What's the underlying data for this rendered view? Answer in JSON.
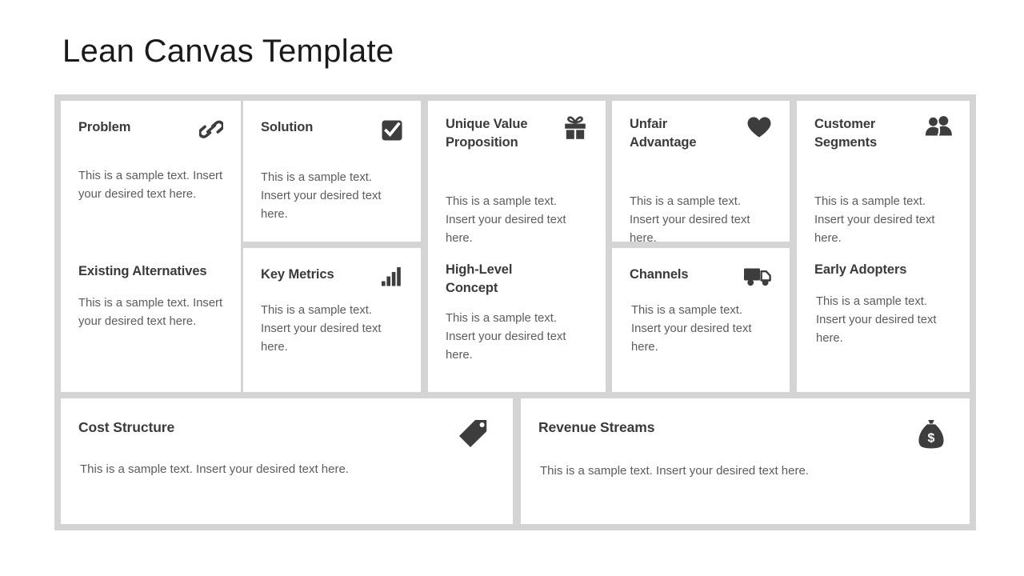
{
  "page": {
    "title": "Lean Canvas Template",
    "background_color": "#ffffff",
    "canvas_background_color": "#d4d4d4",
    "card_background_color": "#ffffff",
    "heading_color": "#3b3b3b",
    "body_color": "#5c5c5c"
  },
  "sample_text": "This is a sample text. Insert your desired text here.",
  "blocks": {
    "problem": {
      "title": "Problem",
      "body": "This is a sample text. Insert your desired text here.",
      "icon": "chain-link-icon"
    },
    "existing_alternatives": {
      "title": "Existing Alternatives",
      "body": "This is a sample text. Insert your desired text here.",
      "icon": null
    },
    "solution": {
      "title": "Solution",
      "body": "This is a sample text. Insert your desired text here.",
      "icon": "check-square-icon"
    },
    "key_metrics": {
      "title": "Key Metrics",
      "body": "This is a sample text. Insert your desired text here.",
      "icon": "bar-chart-icon"
    },
    "unique_value_proposition": {
      "title": "Unique Value Proposition",
      "body": "This is a sample text. Insert your desired text here.",
      "icon": "gift-icon"
    },
    "high_level_concept": {
      "title": "High-Level Concept",
      "body": "This is a sample text. Insert your desired text here.",
      "icon": null
    },
    "unfair_advantage": {
      "title": "Unfair Advantage",
      "body": "This is a sample text. Insert your desired text here.",
      "icon": "heart-icon"
    },
    "channels": {
      "title": "Channels",
      "body": "This is a sample text. Insert your desired text here.",
      "icon": "delivery-truck-icon"
    },
    "customer_segments": {
      "title": "Customer Segments",
      "body": "This is a sample text. Insert your desired text here.",
      "icon": "two-people-icon"
    },
    "early_adopters": {
      "title": "Early Adopters",
      "body": "This is a sample text. Insert your desired text here.",
      "icon": null
    },
    "cost_structure": {
      "title": "Cost Structure",
      "body": "This is a sample text. Insert your desired text here.",
      "icon": "price-tag-icon"
    },
    "revenue_streams": {
      "title": "Revenue Streams",
      "body": "This is a sample text. Insert your desired text here.",
      "icon": "money-bag-icon"
    }
  }
}
